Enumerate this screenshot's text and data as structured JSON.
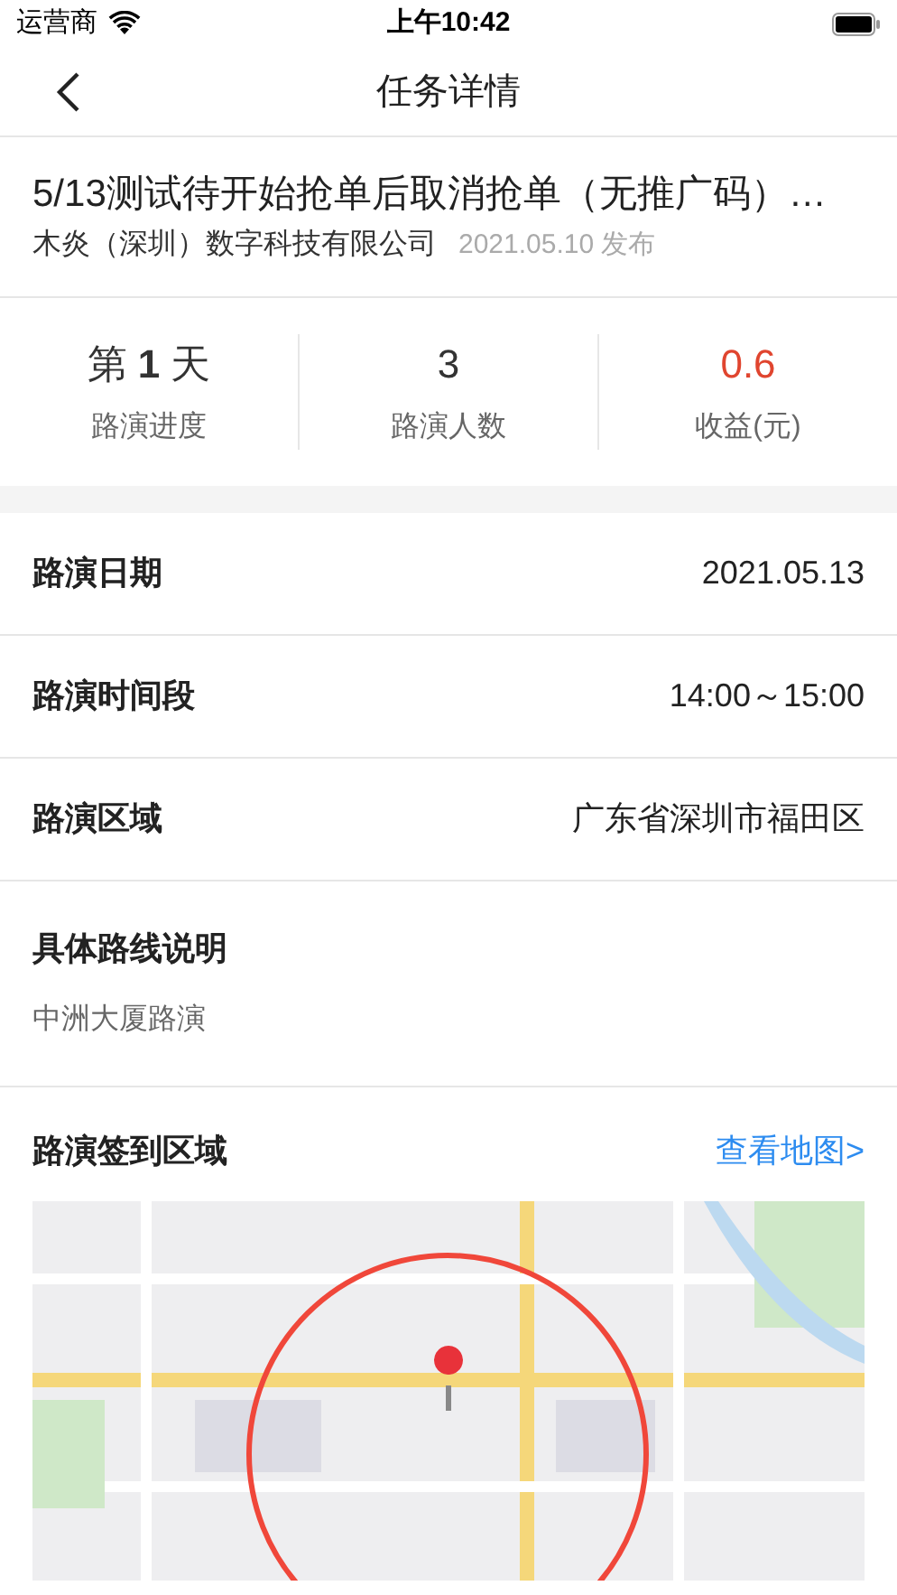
{
  "status_bar": {
    "carrier": "运营商",
    "time": "上午10:42"
  },
  "nav": {
    "title": "任务详情"
  },
  "task": {
    "title": "5/13测试待开始抢单后取消抢单（无推广码）…",
    "company": "木炎（深圳）数字科技有限公司",
    "published": "2021.05.10 发布"
  },
  "stats": [
    {
      "value": "第 **1** 天",
      "label": "路演进度",
      "color": "#333333"
    },
    {
      "value": "3",
      "label": "路演人数",
      "color": "#333333"
    },
    {
      "value": "0.6",
      "label": "收益(元)",
      "color": "#e0452f"
    }
  ],
  "details": [
    {
      "label": "路演日期",
      "value": "2021.05.13"
    },
    {
      "label": "路演时间段",
      "value": "14:00～15:00"
    },
    {
      "label": "路演区域",
      "value": "广东省深圳市福田区"
    }
  ],
  "route": {
    "label": "具体路线说明",
    "text": "中洲大厦路演"
  },
  "checkin": {
    "label": "路演签到区域",
    "link": "查看地图>"
  }
}
